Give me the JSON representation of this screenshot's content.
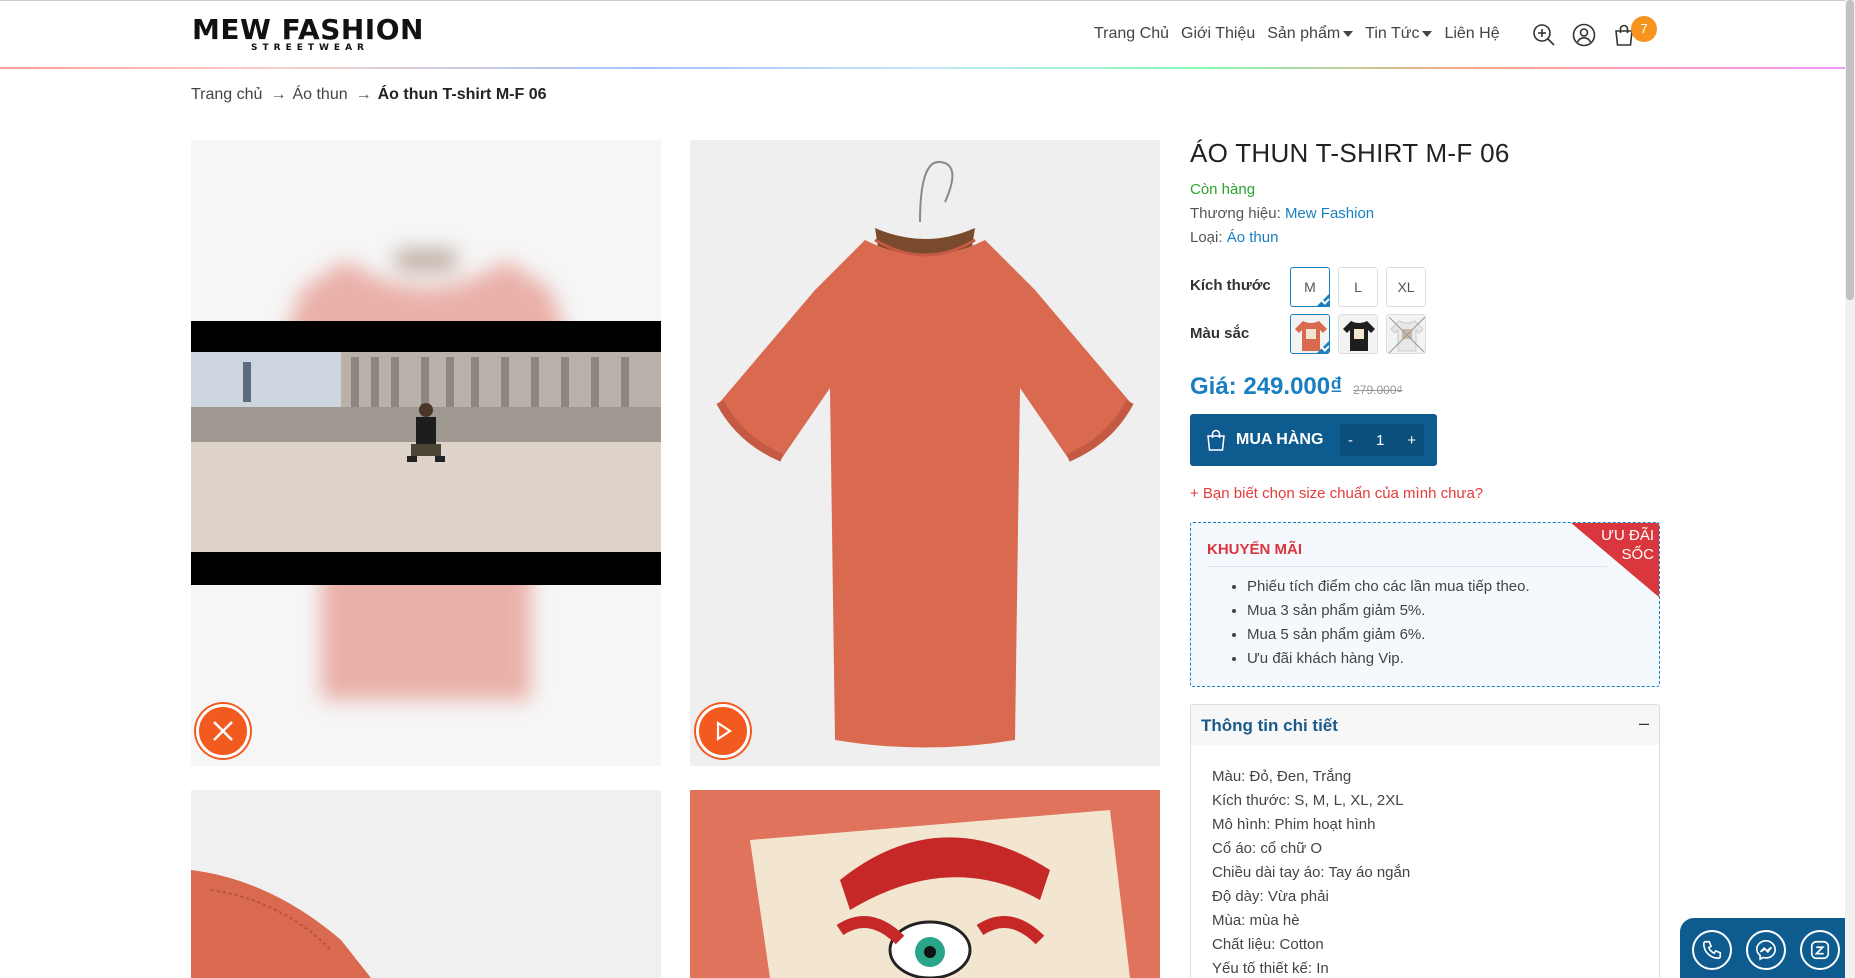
{
  "header": {
    "logo_main": "MEW FASHION",
    "logo_sub": "STREETWEAR",
    "nav": [
      {
        "label": "Trang Chủ"
      },
      {
        "label": "Giới Thiệu"
      },
      {
        "label": "Sản phẩm",
        "dropdown": true
      },
      {
        "label": "Tin Tức",
        "dropdown": true
      },
      {
        "label": "Liên Hệ"
      }
    ],
    "cart_count": "7",
    "icons": [
      "search-icon",
      "user-icon",
      "cart-icon"
    ]
  },
  "breadcrumb": {
    "items": [
      "Trang chủ",
      "Áo thun"
    ],
    "separator": "→",
    "current": "Áo thun T-shirt M-F 06"
  },
  "product": {
    "title": "ÁO THUN T-SHIRT M-F 06",
    "stock": "Còn hàng",
    "brand_label": "Thương hiệu:",
    "brand": "Mew Fashion",
    "type_label": "Loại:",
    "type": "Áo thun",
    "size_label": "Kích thước",
    "sizes": [
      "M",
      "L",
      "XL"
    ],
    "selected_size": "M",
    "color_label": "Màu sắc",
    "colors": [
      {
        "name": "red",
        "hex": "#d9694f"
      },
      {
        "name": "black",
        "hex": "#1e1e1e"
      },
      {
        "name": "white",
        "hex": "#eeeeee"
      }
    ],
    "price_label": "Giá:",
    "price": "249.000₫",
    "price_old": "279.000₫",
    "buy_label": "MUA HÀNG",
    "qty_minus": "-",
    "qty": "1",
    "qty_plus": "+",
    "size_guide": "+ Bạn biết chọn size chuẩn của mình chưa?"
  },
  "promo": {
    "title": "KHUYẾN MÃI",
    "ribbon_line1": "ƯU ĐÃI",
    "ribbon_line2": "SỐC",
    "items": [
      "Phiếu tích điểm cho các lần mua tiếp theo.",
      "Mua 3 sản phẩm giảm 5%.",
      "Mua 5 sản phẩm giảm 6%.",
      "Ưu đãi khách hàng Vip."
    ]
  },
  "details": {
    "title": "Thông tin chi tiết",
    "toggle": "–",
    "specs": [
      "Màu: Đỏ, Đen, Trắng",
      "Kích thước: S, M, L, XL, 2XL",
      "Mô hình: Phim hoạt hình",
      "Cổ áo: cổ chữ O",
      "Chiều dài tay áo: Tay áo ngắn",
      "Độ dày: Vừa phải",
      "Mùa: mùa hè",
      "Chất liệu: Cotton",
      "Yếu tố thiết kế: In"
    ]
  },
  "contact": [
    "phone-icon",
    "messenger-icon",
    "zalo-icon"
  ],
  "colors": {
    "accent": "#1a7fc1",
    "buy_bar": "#0e5b8f",
    "orange": "#f25a1f",
    "stock_green": "#2aa52a",
    "promo_red": "#d9363e"
  }
}
